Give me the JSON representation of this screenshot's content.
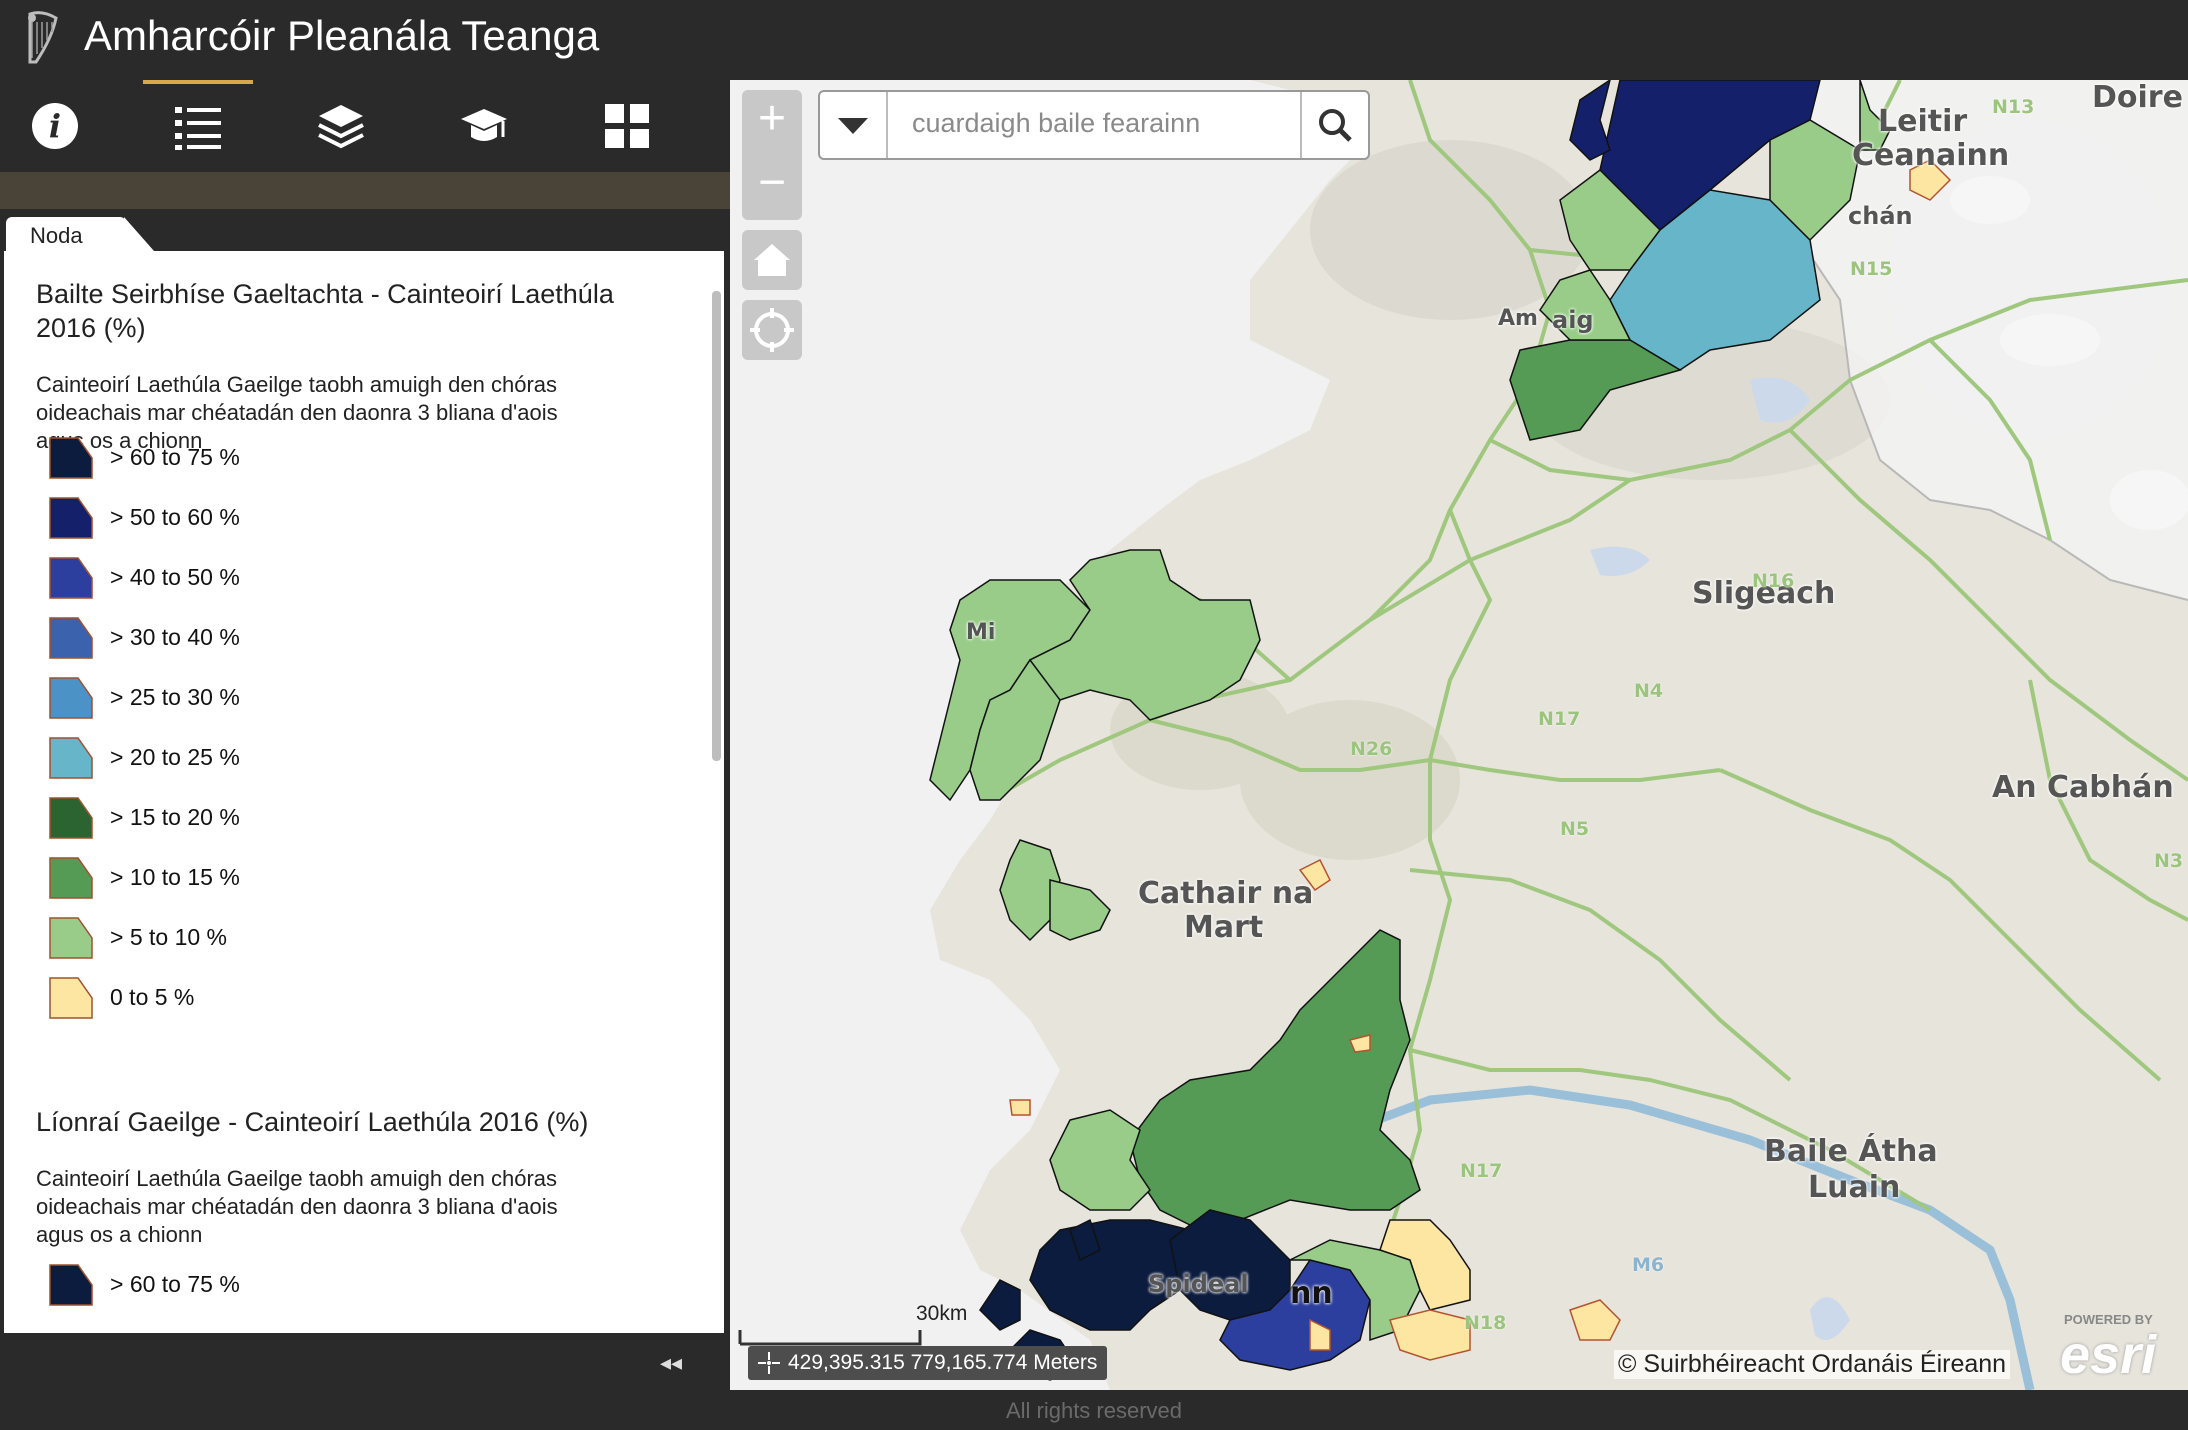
{
  "app": {
    "title": "Amharcóir Pleanála Teanga"
  },
  "toolbar": {
    "items": [
      {
        "icon": "info-icon",
        "active": false
      },
      {
        "icon": "legend-list-icon",
        "active": true
      },
      {
        "icon": "layers-icon",
        "active": false
      },
      {
        "icon": "graduation-cap-icon",
        "active": false
      },
      {
        "icon": "grid-icon",
        "active": false
      }
    ]
  },
  "panel": {
    "tab_label": "Noda",
    "collapse_glyph": "◂◂"
  },
  "legend": {
    "sections": [
      {
        "title": "Bailte Seirbhíse Gaeltachta - Cainteoirí Laethúla 2016 (%)",
        "description": "Cainteoirí Laethúla Gaeilge taobh amuigh den chóras oideachais mar chéatadán den daonra 3 bliana d'aois agus os a chionn",
        "classes": [
          {
            "label": "> 60 to 75 %",
            "color": "#0c1c3e"
          },
          {
            "label": "> 50 to 60 %",
            "color": "#15206a"
          },
          {
            "label": "> 40 to 50 %",
            "color": "#2d3f9e"
          },
          {
            "label": "> 30 to 40 %",
            "color": "#3a62ad"
          },
          {
            "label": "> 25 to 30 %",
            "color": "#4b93c6"
          },
          {
            "label": "> 20 to 25 %",
            "color": "#66b5c9"
          },
          {
            "label": "> 15 to 20 %",
            "color": "#2b6331"
          },
          {
            "label": "> 10 to 15 %",
            "color": "#559a55"
          },
          {
            "label": "> 5 to 10 %",
            "color": "#98cc88"
          },
          {
            "label": "0 to 5 %",
            "color": "#fde6a2"
          }
        ]
      },
      {
        "title": "Líonraí Gaeilge - Cainteoirí Laethúla 2016 (%)",
        "description": "Cainteoirí Laethúla Gaeilge taobh amuigh den chóras oideachais mar chéatadán den daonra 3 bliana d'aois agus os a chionn",
        "classes": [
          {
            "label": "> 60 to 75 %",
            "color": "#0c1c3e"
          }
        ]
      }
    ]
  },
  "map": {
    "search_placeholder": "cuardaigh baile fearainn",
    "zoom_in": "+",
    "zoom_out": "−",
    "scale_label": "30km",
    "coordinates": "429,395.315 779,165.774 Meters",
    "attribution": "© Suirbhéireacht Ordanáis Éireann",
    "esri_powered": "POWERED BY",
    "esri_logo": "esri",
    "place_labels": [
      "Leitir Ceanainn",
      "Doire",
      "Sligeach",
      "An Cabhán",
      "Cathair na Mart",
      "Baile Átha Luain",
      "Spideal",
      "nn",
      "Am",
      "aig",
      "Mi",
      "chán"
    ],
    "road_labels": [
      "N13",
      "N15",
      "N16",
      "N4",
      "N17",
      "N26",
      "N5",
      "N3",
      "N17",
      "N18",
      "M6"
    ]
  },
  "footer": {
    "text": "All rights reserved"
  }
}
